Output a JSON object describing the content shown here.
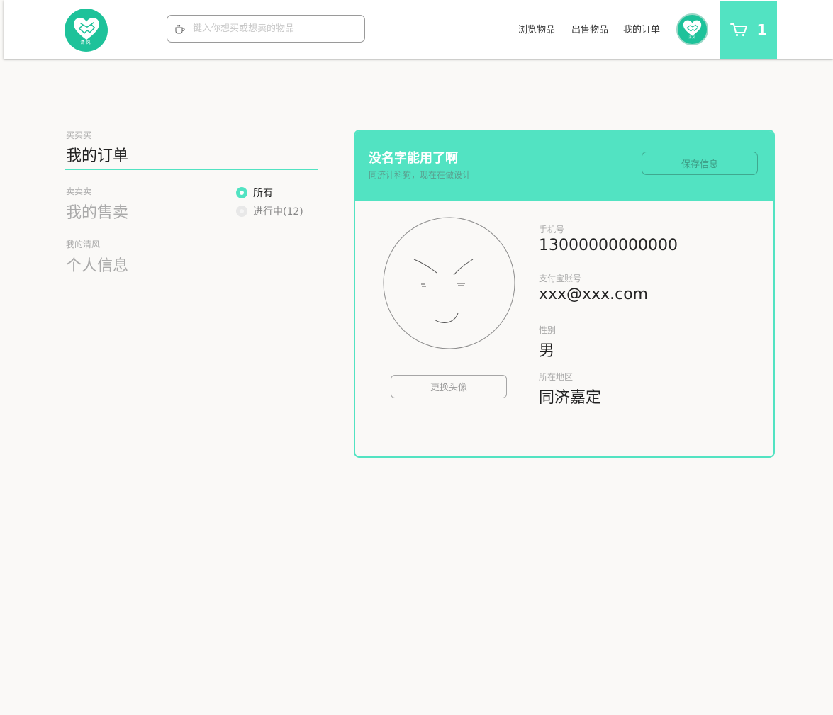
{
  "header": {
    "logo_text": "清风",
    "search_placeholder": "键入你想买或想卖的物品",
    "nav": [
      "浏览物品",
      "出售物品",
      "我的订单"
    ],
    "cart_count": "1",
    "accent_color": "#52e3c2",
    "logo_color": "#1ec29a"
  },
  "menu": {
    "sections": [
      {
        "small": "买买买",
        "big": "我的订单"
      },
      {
        "small": "卖卖卖",
        "big": "我的售卖"
      },
      {
        "small": "我的清风",
        "big": "个人信息"
      }
    ],
    "filters": [
      {
        "label": "所有",
        "selected": true
      },
      {
        "label": "进行中(12)",
        "selected": false
      }
    ]
  },
  "profile": {
    "name": "没名字能用了啊",
    "bio": "同济计科狗，现在在做设计",
    "save_label": "保存信息",
    "change_avatar_label": "更换头像",
    "fields": [
      {
        "label": "手机号",
        "value": "13000000000000"
      },
      {
        "label": "支付宝账号",
        "value": "xxx@xxx.com"
      },
      {
        "label": "性别",
        "value": "男"
      },
      {
        "label": "所在地区",
        "value": "同济嘉定"
      }
    ]
  }
}
